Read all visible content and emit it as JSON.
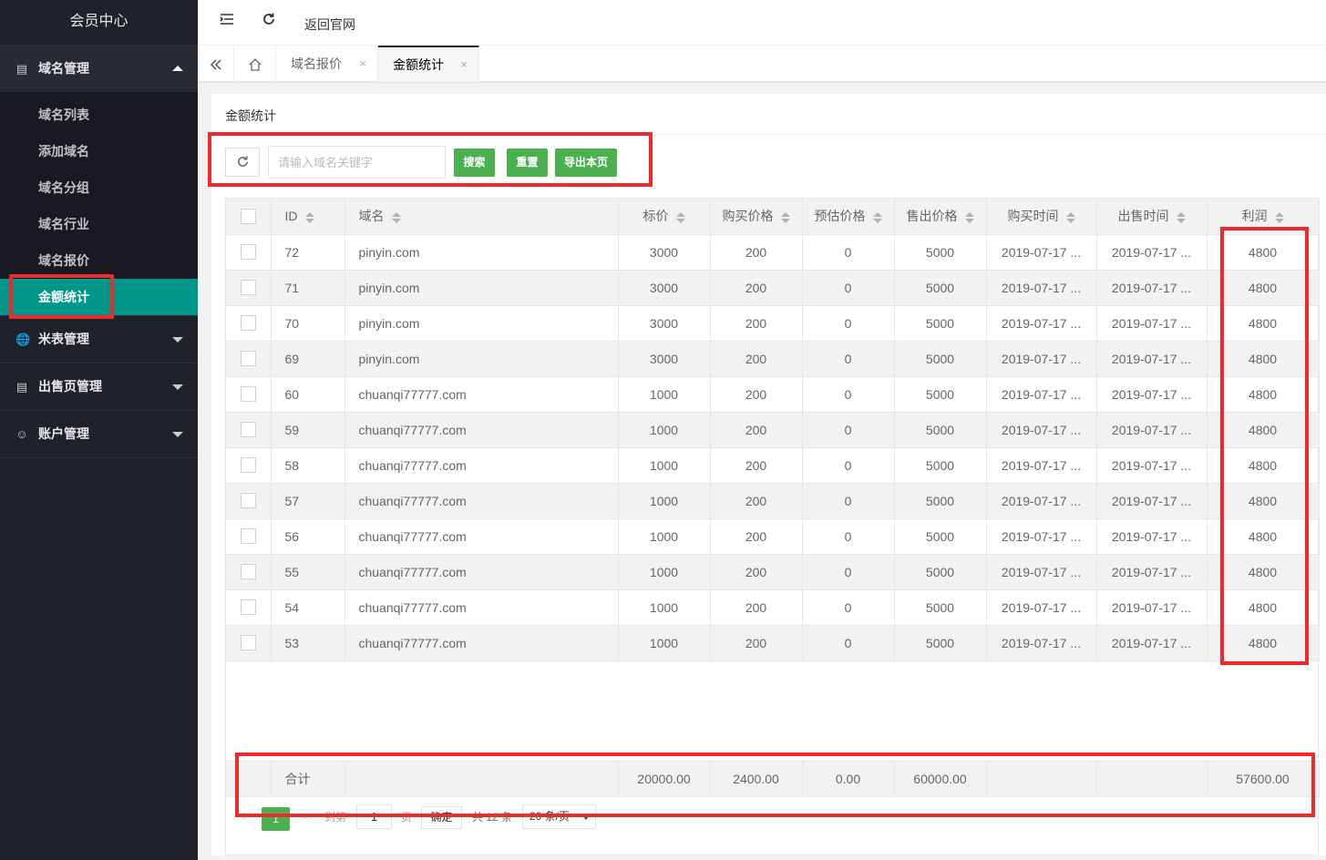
{
  "sidebar": {
    "title": "会员中心",
    "groups": [
      {
        "label": "域名管理",
        "icon": "document-icon",
        "open": true,
        "items": [
          {
            "label": "域名列表"
          },
          {
            "label": "添加域名"
          },
          {
            "label": "域名分组"
          },
          {
            "label": "域名行业"
          },
          {
            "label": "域名报价"
          },
          {
            "label": "金额统计",
            "active": true
          }
        ]
      },
      {
        "label": "米表管理",
        "icon": "globe-icon"
      },
      {
        "label": "出售页管理",
        "icon": "document-icon"
      },
      {
        "label": "账户管理",
        "icon": "user-icon"
      }
    ]
  },
  "header": {
    "back_link": "返回官网"
  },
  "tabs": [
    {
      "label": "域名报价",
      "close": "×"
    },
    {
      "label": "金额统计",
      "close": "×",
      "active": true
    }
  ],
  "card": {
    "title": "金额统计"
  },
  "toolbar": {
    "search_placeholder": "请输入域名关键字",
    "search_button": "搜索",
    "reset_button": "重置",
    "export_button": "导出本页"
  },
  "table": {
    "columns": [
      "ID",
      "域名",
      "标价",
      "购买价格",
      "预估价格",
      "售出价格",
      "购买时间",
      "出售时间",
      "利润"
    ],
    "rows": [
      [
        "72",
        "pinyin.com",
        "3000",
        "200",
        "0",
        "5000",
        "2019-07-17 ...",
        "2019-07-17 ...",
        "4800"
      ],
      [
        "71",
        "pinyin.com",
        "3000",
        "200",
        "0",
        "5000",
        "2019-07-17 ...",
        "2019-07-17 ...",
        "4800"
      ],
      [
        "70",
        "pinyin.com",
        "3000",
        "200",
        "0",
        "5000",
        "2019-07-17 ...",
        "2019-07-17 ...",
        "4800"
      ],
      [
        "69",
        "pinyin.com",
        "3000",
        "200",
        "0",
        "5000",
        "2019-07-17 ...",
        "2019-07-17 ...",
        "4800"
      ],
      [
        "60",
        "chuanqi77777.com",
        "1000",
        "200",
        "0",
        "5000",
        "2019-07-17 ...",
        "2019-07-17 ...",
        "4800"
      ],
      [
        "59",
        "chuanqi77777.com",
        "1000",
        "200",
        "0",
        "5000",
        "2019-07-17 ...",
        "2019-07-17 ...",
        "4800"
      ],
      [
        "58",
        "chuanqi77777.com",
        "1000",
        "200",
        "0",
        "5000",
        "2019-07-17 ...",
        "2019-07-17 ...",
        "4800"
      ],
      [
        "57",
        "chuanqi77777.com",
        "1000",
        "200",
        "0",
        "5000",
        "2019-07-17 ...",
        "2019-07-17 ...",
        "4800"
      ],
      [
        "56",
        "chuanqi77777.com",
        "1000",
        "200",
        "0",
        "5000",
        "2019-07-17 ...",
        "2019-07-17 ...",
        "4800"
      ],
      [
        "55",
        "chuanqi77777.com",
        "1000",
        "200",
        "0",
        "5000",
        "2019-07-17 ...",
        "2019-07-17 ...",
        "4800"
      ],
      [
        "54",
        "chuanqi77777.com",
        "1000",
        "200",
        "0",
        "5000",
        "2019-07-17 ...",
        "2019-07-17 ...",
        "4800"
      ],
      [
        "53",
        "chuanqi77777.com",
        "1000",
        "200",
        "0",
        "5000",
        "2019-07-17 ...",
        "2019-07-17 ...",
        "4800"
      ]
    ],
    "total": {
      "label": "合计",
      "list_price": "20000.00",
      "buy_price": "2400.00",
      "est_price": "0.00",
      "sell_price": "60000.00",
      "profit": "57600.00"
    }
  },
  "pager": {
    "prev": "<",
    "current": "1",
    "next": ">",
    "goto_label": "到第",
    "goto_value": "1",
    "page_unit": "页",
    "confirm": "确定",
    "total": "共 12 条",
    "page_size": "20 条/页"
  },
  "colors": {
    "sidebar_bg": "#20222a",
    "active": "#009688",
    "button": "#4caf50",
    "highlight": "#ee2a2e"
  }
}
